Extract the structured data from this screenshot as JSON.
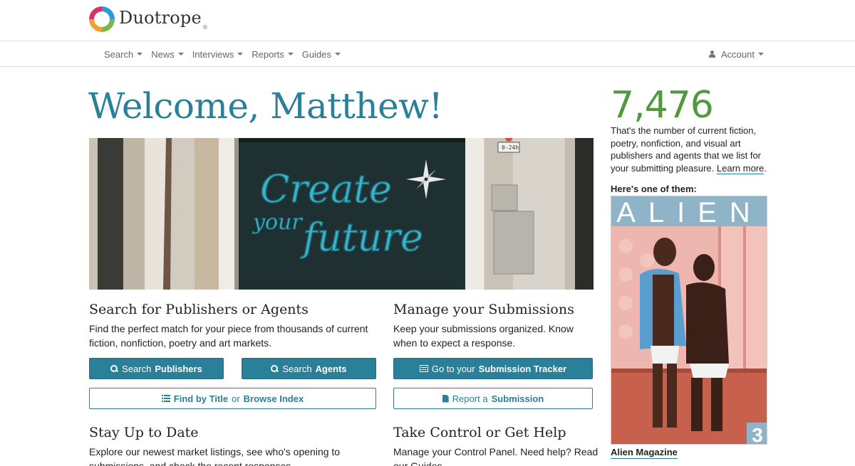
{
  "brand": {
    "name": "Duotrope",
    "reg": "®"
  },
  "nav": {
    "items": [
      {
        "label": "Search"
      },
      {
        "label": "News"
      },
      {
        "label": "Interviews"
      },
      {
        "label": "Reports"
      },
      {
        "label": "Guides"
      }
    ],
    "account_label": "Account"
  },
  "welcome": "Welcome, Matthew!",
  "hero": {
    "mural_line1": "Create",
    "mural_line2": "your",
    "mural_line3": "future",
    "sign": "0-24h"
  },
  "search_section": {
    "title": "Search for Publishers or Agents",
    "text": "Find the perfect match for your piece from thousands of current fiction, nonfiction, poetry and art markets.",
    "btn_publishers": {
      "prefix": "Search",
      "bold": "Publishers"
    },
    "btn_agents": {
      "prefix": "Search",
      "bold": "Agents"
    },
    "btn_find": {
      "bold1": "Find by Title",
      "mid": "or",
      "bold2": "Browse Index"
    }
  },
  "manage_section": {
    "title": "Manage your Submissions",
    "text": "Keep your submissions organized. Know when to expect a response.",
    "btn_tracker": {
      "prefix": "Go to your",
      "bold": "Submission Tracker"
    },
    "btn_report": {
      "prefix": "Report a",
      "bold": "Submission"
    }
  },
  "stay_section": {
    "title": "Stay Up to Date",
    "text": "Explore our newest market listings, see who's opening to submissions, and check the recent responses."
  },
  "control_section": {
    "title": "Take Control or Get Help",
    "text": "Manage your Control Panel. Need help? Read our Guides."
  },
  "sidebar": {
    "count": "7,476",
    "text": "That's the number of current fiction, poetry, nonfiction, and visual art publishers and agents that we list for your submitting pleasure.",
    "learn_more": "Learn more",
    "here_label": "Here's one of them:",
    "cover_title": "ALIEN",
    "cover_issue": "3",
    "caption": "Alien Magazine"
  },
  "colors": {
    "accent": "#2a7f99",
    "stat_green": "#4e9a3c"
  }
}
